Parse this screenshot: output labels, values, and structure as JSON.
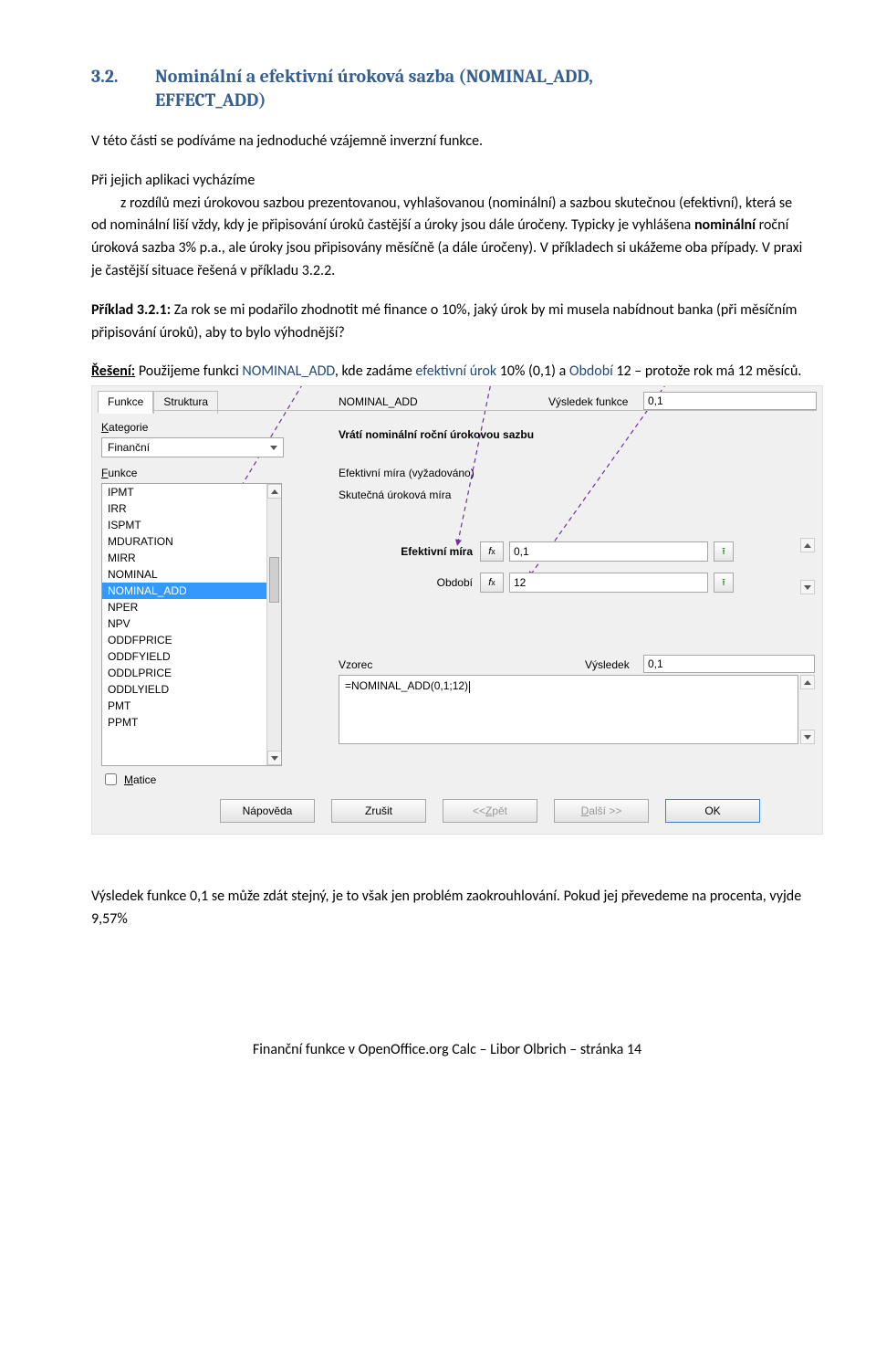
{
  "heading": {
    "num": "3.2.",
    "title_line1": "Nominální a efektivní úroková sazba (NOMINAL_ADD,",
    "title_line2": "EFFECT_ADD)"
  },
  "p1": "V této části se podíváme na jednoduché vzájemně inverzní funkce.",
  "p2a": "Při jejich aplikaci vycházíme",
  "p2b": "z rozdílů mezi úrokovou sazbou prezentovanou, vyhlašovanou (nominální) a sazbou skutečnou (efektivní), která se od nominální liší vždy, kdy je připisování úroků častější a úroky jsou dále úročeny. Typicky je vyhlášena ",
  "p2c": "nominální",
  "p2d": " roční úroková sazba 3% p.a., ale úroky jsou připisovány měsíčně (a dále úročeny). V příkladech si ukážeme oba případy. V praxi je častější situace řešená v příkladu 3.2.2.",
  "priklad_label": "Příklad 3.2.1:",
  "priklad_body": " Za rok se mi podařilo zhodnotit mé finance o 10%, jaký úrok by mi musela nabídnout banka (při měsíčním připisování úroků), aby to bylo výhodnější?",
  "reseni_label": "Řešení:",
  "reseni_t1": " Použijeme funkci ",
  "reseni_fn": "NOMINAL_ADD",
  "reseni_t2": ", kde zadáme ",
  "reseni_ef": "efektivní úrok",
  "reseni_t3": " 10% (0,1) a ",
  "reseni_ob": "Období",
  "reseni_t4": " 12 – protože rok má 12 měsíců.",
  "dialog": {
    "tab1": "Funkce",
    "tab2": "Struktura",
    "kat_label_pre": "K",
    "kat_label_rest": "ategorie",
    "kat_value": "Finanční",
    "fnc_label_pre": "F",
    "fnc_label_rest": "unkce",
    "fn_items": [
      "IPMT",
      "IRR",
      "ISPMT",
      "MDURATION",
      "MIRR",
      "NOMINAL",
      "NOMINAL_ADD",
      "NPER",
      "NPV",
      "ODDFPRICE",
      "ODDFYIELD",
      "ODDLPRICE",
      "ODDLYIELD",
      "PMT",
      "PPMT"
    ],
    "fn_selected_index": 6,
    "matice_pre": "M",
    "matice_rest": "atice",
    "fnname": "NOMINAL_ADD",
    "result_label": "Výsledek funkce",
    "result_value": "0,1",
    "desc": "Vrátí nominální roční úrokovou sazbu",
    "desc2": "Efektivní míra (vyžadováno)",
    "desc3": "Skutečná úroková míra",
    "param1_label": "Efektivní míra",
    "param1_value": "0,1",
    "param2_label": "Období",
    "param2_value": "12",
    "fx": "fx",
    "vzorec_label": "Vzorec",
    "vysledek_label": "Výsledek",
    "vysledek_value": "0,1",
    "vzorec_value": "=NOMINAL_ADD(0,1;12)",
    "btn_help": "Nápověda",
    "btn_cancel": "Zrušit",
    "btn_back_pre": "<<  ",
    "btn_back_u": "Z",
    "btn_back_rest": "pět",
    "btn_next_u": "D",
    "btn_next_rest": "alší >>",
    "btn_ok": "OK"
  },
  "after": "Výsledek funkce 0,1 se může zdát stejný, je to však jen problém zaokrouhlování. Pokud jej převedeme na procenta, vyjde 9,57%",
  "footer": "Finanční funkce v OpenOffice.org Calc – Libor Olbrich – stránka 14"
}
